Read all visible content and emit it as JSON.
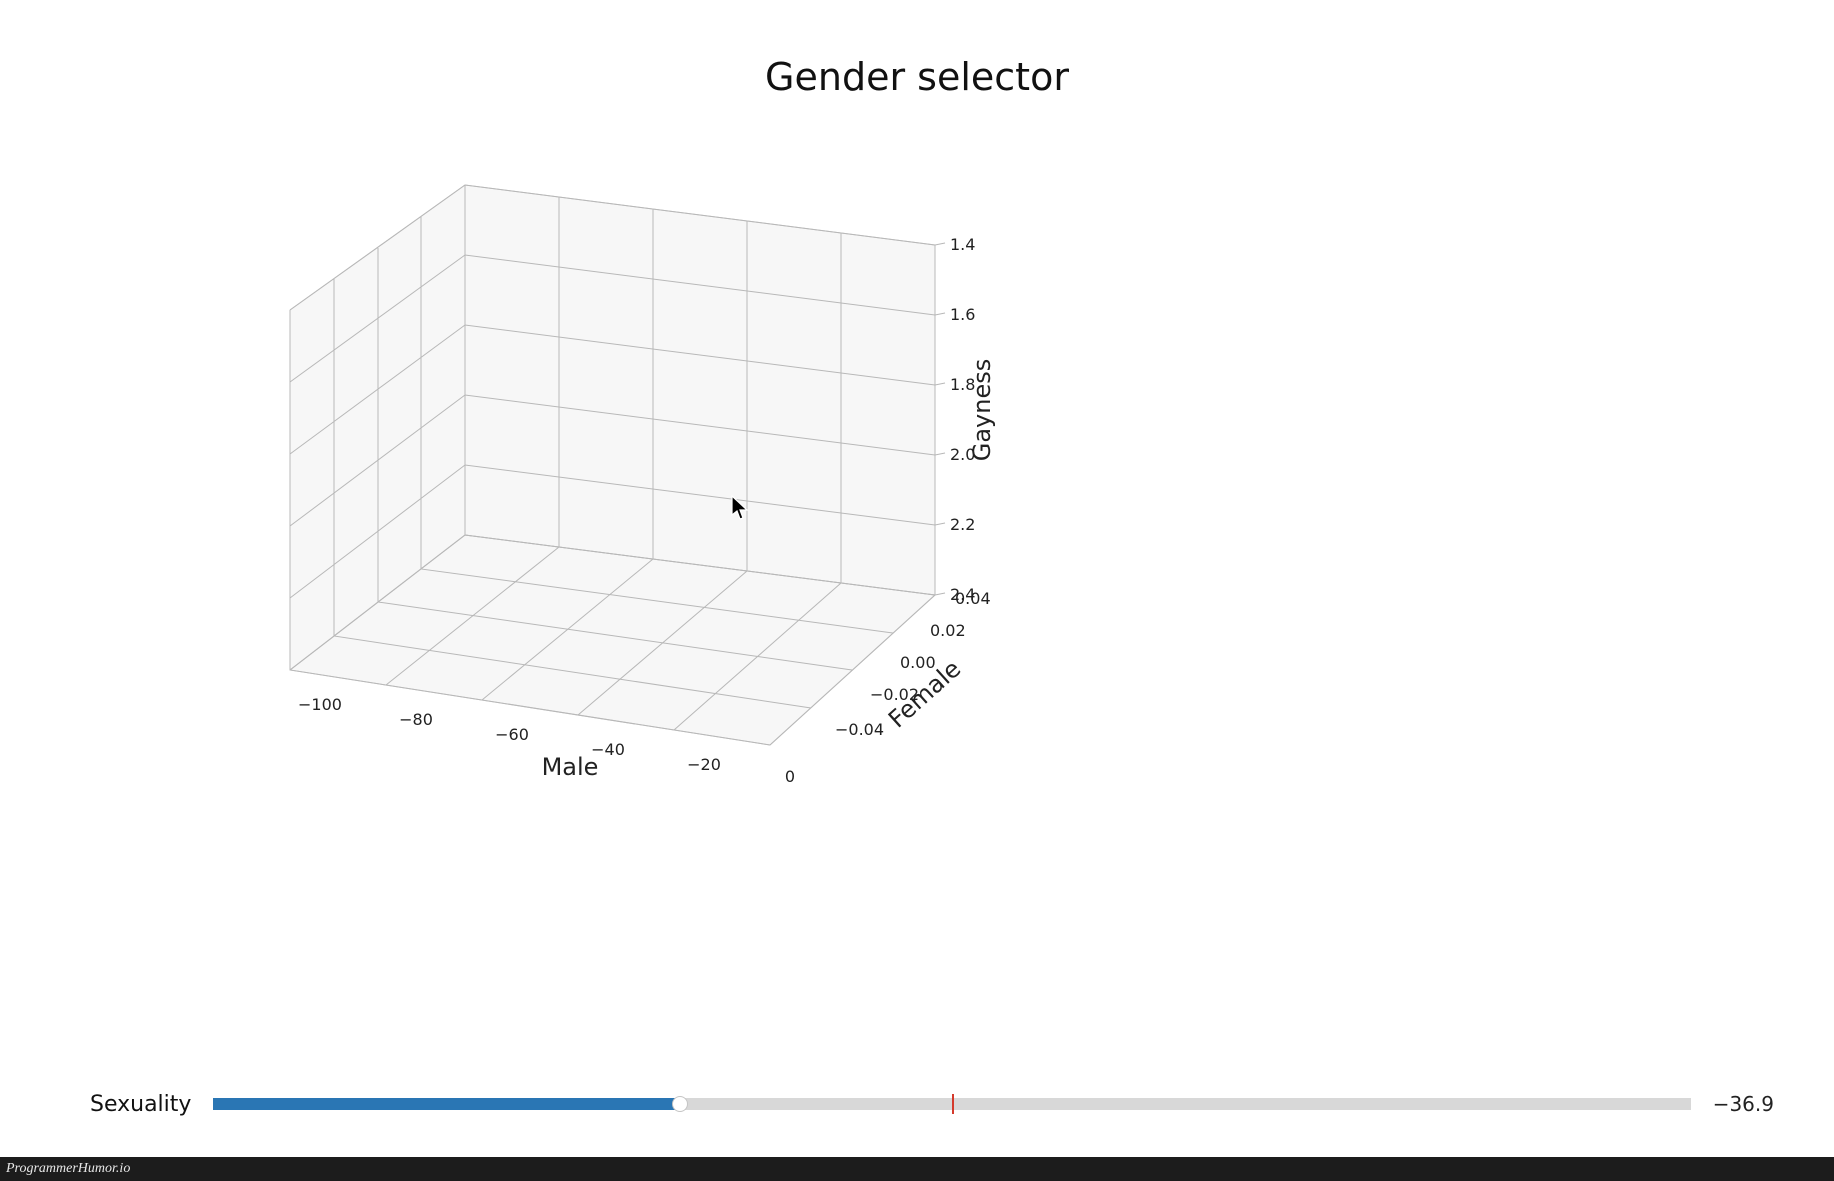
{
  "title": "Gender selector",
  "chart_data": {
    "type": "scatter",
    "is_3d": true,
    "series": [],
    "x_axis": {
      "label": "Male",
      "ticks": [
        -100,
        -80,
        -60,
        -40,
        -20,
        0
      ],
      "range": [
        -110,
        5
      ]
    },
    "y_axis": {
      "label": "Female",
      "ticks": [
        -0.04,
        -0.02,
        0.0,
        0.02,
        0.04
      ],
      "range": [
        -0.05,
        0.05
      ]
    },
    "z_axis": {
      "label": "Gayness",
      "ticks": [
        -1.4,
        -1.6,
        -1.8,
        -2.0,
        -2.2,
        -2.4
      ],
      "range": [
        -2.5,
        -1.3
      ],
      "tick_label_prefix": ""
    },
    "z_ticks_display": [
      "1.4",
      "1.6",
      "1.8",
      "2.0",
      "2.2",
      "2.4"
    ],
    "y_ticks_display": [
      "−0.04",
      "−0.02",
      "0.00",
      "0.02",
      "0.04"
    ],
    "x_ticks_display": [
      "−100",
      "−80",
      "−60",
      "−40",
      "−20",
      "0"
    ]
  },
  "slider": {
    "label": "Sexuality",
    "value": -36.9,
    "value_display": "−36.9",
    "min": -100,
    "max": 100,
    "center_mark": 0,
    "fill_color": "#2a76b4"
  },
  "watermark": "ProgrammerHumor.io"
}
